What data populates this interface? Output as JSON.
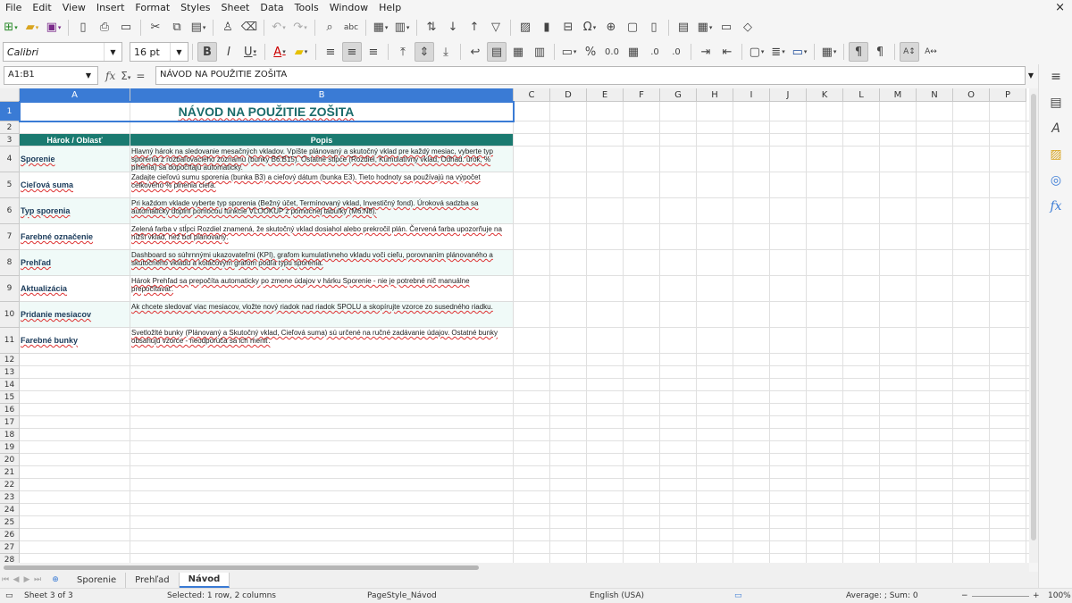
{
  "menu": [
    "File",
    "Edit",
    "View",
    "Insert",
    "Format",
    "Styles",
    "Sheet",
    "Data",
    "Tools",
    "Window",
    "Help"
  ],
  "window_close": "×",
  "toolbar2": {
    "font_name": "Calibri",
    "font_size": "16 pt"
  },
  "formula_bar": {
    "name_box": "A1:B1",
    "content": "NÁVOD NA POUŽITIE ZOŠITA"
  },
  "columns": [
    "A",
    "B",
    "C",
    "D",
    "E",
    "F",
    "G",
    "H",
    "I",
    "J",
    "K",
    "L",
    "M",
    "N",
    "O",
    "P"
  ],
  "rows": [
    "1",
    "2",
    "3",
    "4",
    "5",
    "6",
    "7",
    "8",
    "9",
    "10",
    "11",
    "12",
    "13",
    "14",
    "15",
    "16",
    "17",
    "18",
    "19",
    "20",
    "21",
    "22",
    "23",
    "24",
    "25",
    "26",
    "27",
    "28"
  ],
  "sheet": {
    "title": "NÁVOD NA POUŽITIE ZOŠITA",
    "header_a": "Hárok / Oblasť",
    "header_b": "Popis",
    "items": [
      {
        "a": "Sporenie",
        "b": "Hlavný hárok na sledovanie mesačných vkladov. Vpíšte plánovaný a skutočný vklad pre každý mesiac, vyberte typ sporenia z rozbaľovacieho zoznamu (bunky B6:B15). Ostatné stĺpce (Rozdiel, Kumulatívny vklad, Odhad. úrok, % plnenia) sa dopočítajú automaticky."
      },
      {
        "a": "Cieľová suma",
        "b": "Zadajte cieľovú sumu sporenia (bunka B3) a cieľový dátum (bunka E3). Tieto hodnoty sa používajú na výpočet celkového % plnenia cieľa."
      },
      {
        "a": "Typ sporenia",
        "b": "Pri každom vklade vyberte typ sporenia (Bežný účet, Termínovaný vklad, Investičný fond). Úroková sadzba sa automaticky doplní pomocou funkcie VLOOKUP z pomocnej tabuľky (M6:N8)."
      },
      {
        "a": "Farebné označenie",
        "b": "Zelená farba v stĺpci Rozdiel znamená, že skutočný vklad dosiahol alebo prekročil plán. Červená farba upozorňuje na nižší vklad, než bol plánovaný."
      },
      {
        "a": "Prehľad",
        "b": "Dashboard so súhrnnými ukazovateľmi (KPI), grafom kumulatívneho vkladu voči cieľu, porovnaním plánovaného a skutočného vkladu a koláčovým grafom podľa typu sporenia."
      },
      {
        "a": "Aktualizácia",
        "b": "Hárok Prehľad sa prepočíta automaticky po zmene údajov v hárku Sporenie - nie je potrebné nič manuálne prepočítavať."
      },
      {
        "a": "Pridanie mesiacov",
        "b": "Ak chcete sledovať viac mesiacov, vložte nový riadok nad riadok SPOLU a skopírujte vzorce zo susedného riadku."
      },
      {
        "a": "Farebné bunky",
        "b": "Svetložlté bunky (Plánovaný a Skutočný vklad, Cieľová suma) sú určené na ručné zadávanie údajov. Ostatné bunky obsahujú vzorce - neodporúča sa ich meniť."
      }
    ]
  },
  "tabs": [
    "Sporenie",
    "Prehľad",
    "Návod"
  ],
  "active_tab": "Návod",
  "status": {
    "sheet": "Sheet 3 of 3",
    "selection": "Selected: 1 row, 2 columns",
    "page_style": "PageStyle_Návod",
    "language": "English (USA)",
    "summary": "Average: ; Sum: 0",
    "zoom": "100%"
  },
  "colors": {
    "header_teal": "#1a7a70",
    "title_teal": "#1a6b6b",
    "selection_blue": "#3a7bd5",
    "row_band": "#f0faf8"
  }
}
